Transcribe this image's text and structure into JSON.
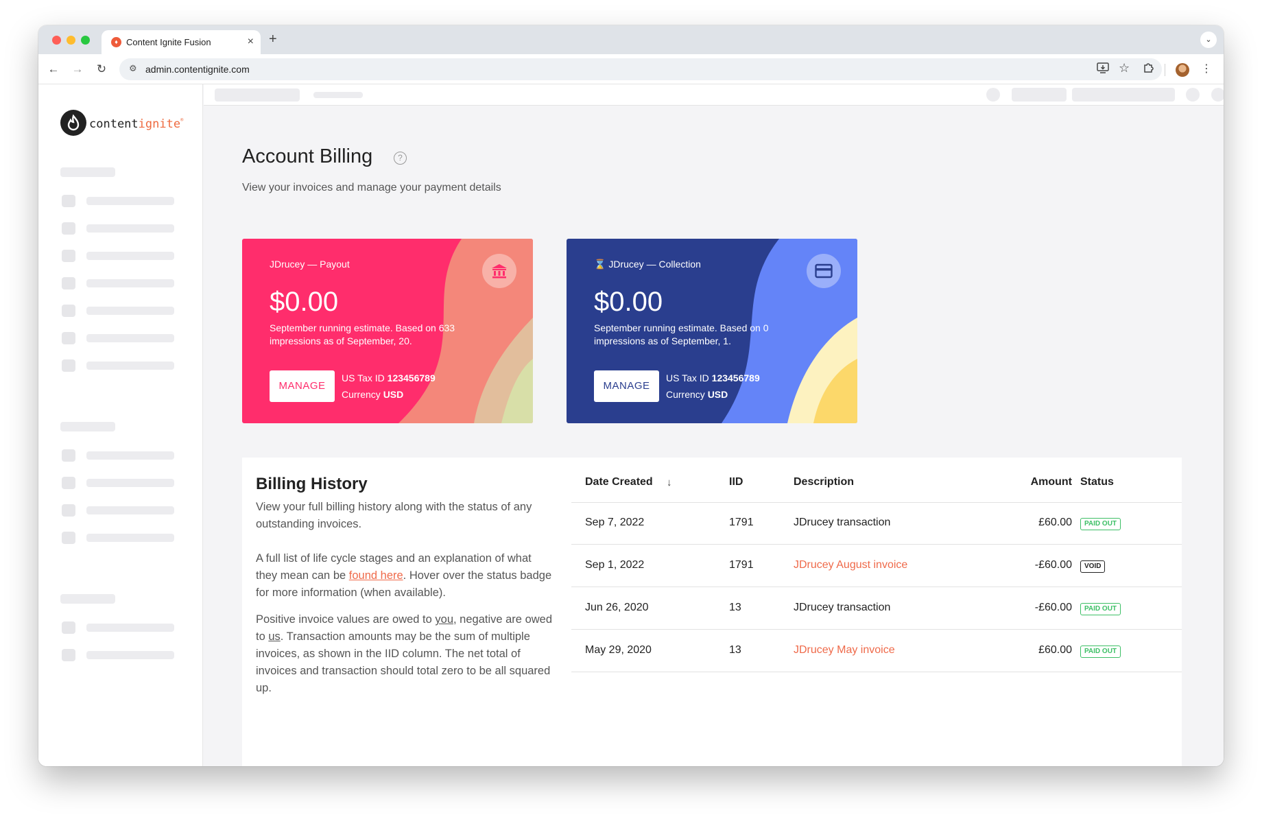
{
  "browser": {
    "tab_title": "Content Ignite Fusion",
    "url": "admin.contentignite.com",
    "favicon_glyph": "♦"
  },
  "logo": {
    "text_main": "content",
    "text_accent": "ignite",
    "registered": "®",
    "accent_color": "#ee6a3f"
  },
  "page": {
    "title": "Account Billing",
    "help_glyph": "?",
    "subtitle": "View your invoices and manage your payment details"
  },
  "cards": {
    "payout": {
      "label": "JDrucey — Payout",
      "amount": "$0.00",
      "estimate": "September running estimate. Based on 633 impressions as of September, 20.",
      "manage_label": "MANAGE",
      "tax_label": "US Tax ID",
      "tax_value": "123456789",
      "currency_label": "Currency",
      "currency_value": "USD",
      "icon": "bank-icon",
      "color": "#ff2d6c"
    },
    "collection": {
      "label": "JDrucey — Collection",
      "amount": "$0.00",
      "estimate": "September running estimate. Based on 0 impressions as of September, 1.",
      "manage_label": "MANAGE",
      "tax_label": "US Tax ID",
      "tax_value": "123456789",
      "currency_label": "Currency",
      "currency_value": "USD",
      "icon": "credit-card-icon",
      "status_icon": "hourglass-icon",
      "color": "#2a3e8e"
    }
  },
  "history": {
    "title": "Billing History",
    "desc1": "View your full billing history along with the status of any outstanding invoices.",
    "desc2_before": "A full list of life cycle stages and an explanation of what they mean can be ",
    "desc2_link": "found here",
    "desc2_after": ". Hover over the status badge for more information (when available).",
    "desc3_a": "Positive invoice values are owed to ",
    "desc3_you": "you",
    "desc3_b": ", negative are owed to ",
    "desc3_us": "us",
    "desc3_c": ". Transaction amounts may be the sum of multiple invoices, as shown in the IID column. The net total of invoices and transaction should total zero to be all squared up.",
    "columns": {
      "date": "Date Created",
      "iid": "IID",
      "description": "Description",
      "amount": "Amount",
      "status": "Status"
    },
    "sort_icon": "arrow-down-icon",
    "rows": [
      {
        "date": "Sep 7, 2022",
        "iid": "1791",
        "description": "JDrucey transaction",
        "amount": "£60.00",
        "status": "PAID OUT"
      },
      {
        "date": "Sep 1, 2022",
        "iid": "1791",
        "description": "JDrucey August invoice",
        "amount": "-£60.00",
        "status": "VOID"
      },
      {
        "date": "Jun 26, 2020",
        "iid": "13",
        "description": "JDrucey transaction",
        "amount": "-£60.00",
        "status": "PAID OUT"
      },
      {
        "date": "May 29, 2020",
        "iid": "13",
        "description": "JDrucey May invoice",
        "amount": "£60.00",
        "status": "PAID OUT"
      }
    ],
    "status_colors": {
      "paid": "#3cbf65",
      "void": "#222222"
    }
  }
}
